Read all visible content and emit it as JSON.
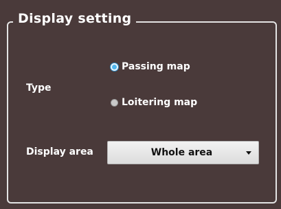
{
  "panel": {
    "title": "Display setting"
  },
  "type": {
    "label": "Type",
    "options": [
      {
        "label": "Passing map",
        "selected": true
      },
      {
        "label": "Loitering map",
        "selected": false
      }
    ]
  },
  "display_area": {
    "label": "Display area",
    "value": "Whole area"
  }
}
